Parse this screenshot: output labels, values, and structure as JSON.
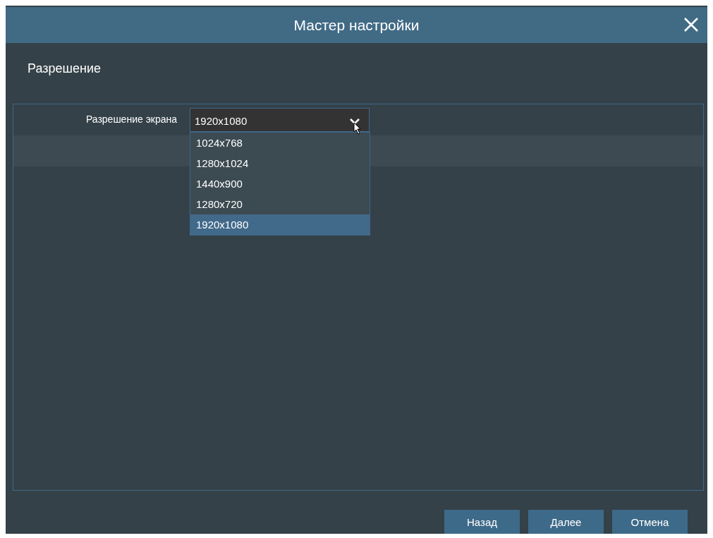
{
  "window": {
    "title": "Мастер настройки"
  },
  "section": {
    "title": "Разрешение"
  },
  "field": {
    "label": "Разрешение экрана",
    "value": "1920x1080",
    "expanded": true,
    "options": [
      {
        "label": "1024x768",
        "selected": false
      },
      {
        "label": "1280x1024",
        "selected": false
      },
      {
        "label": "1440x900",
        "selected": false
      },
      {
        "label": "1280x720",
        "selected": false
      },
      {
        "label": "1920x1080",
        "selected": true
      }
    ]
  },
  "buttons": [
    "Назад",
    "Далее",
    "Отмена"
  ]
}
